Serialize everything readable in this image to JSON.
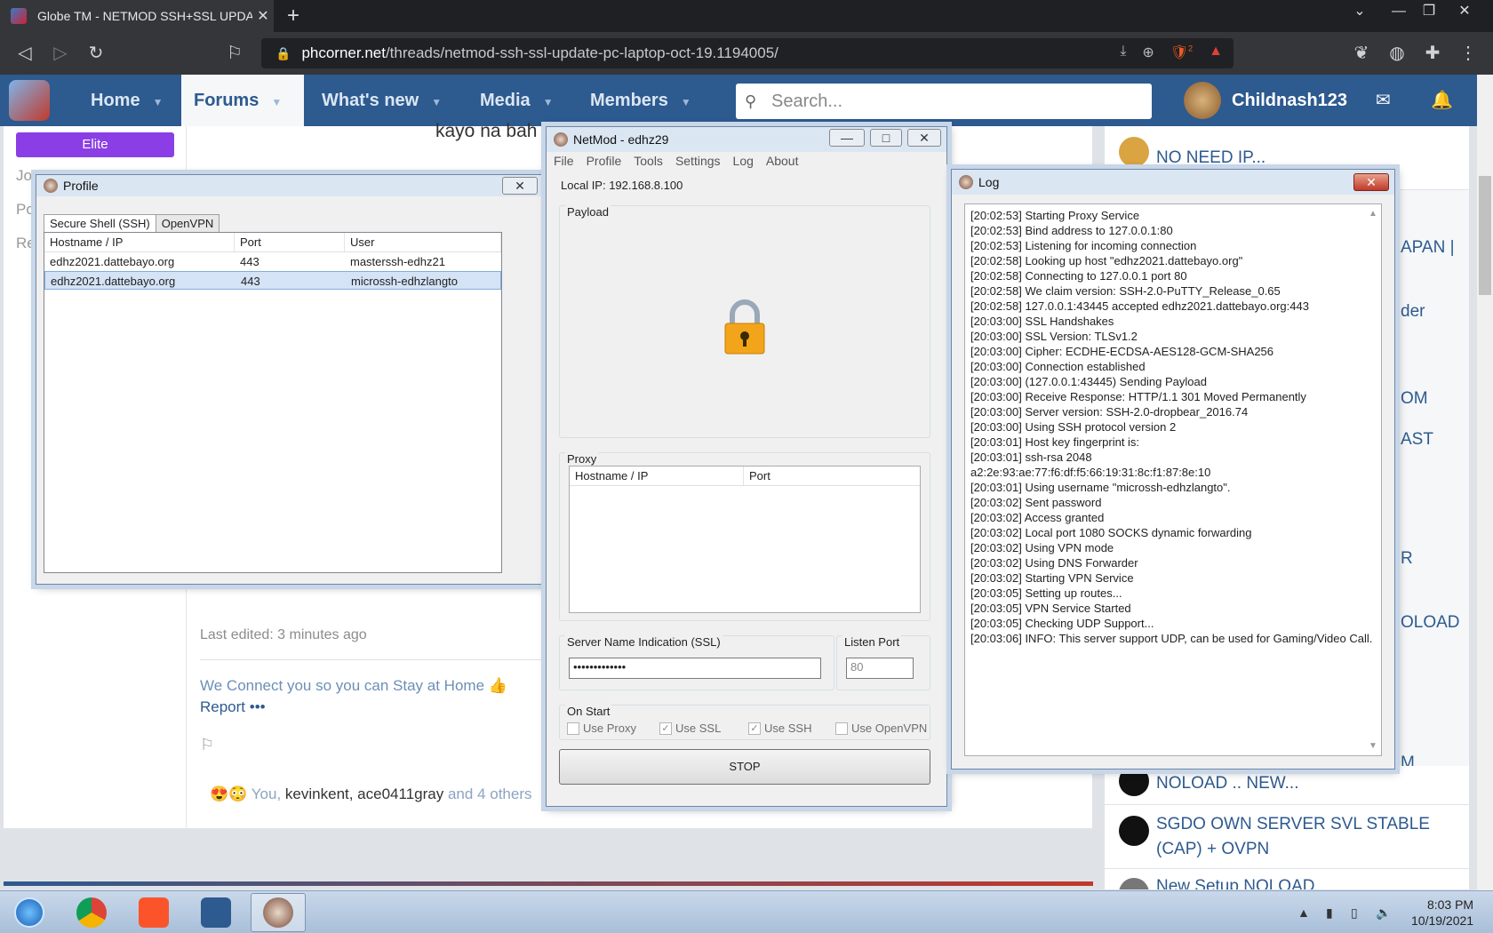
{
  "browser": {
    "tab_title": "Globe TM - NETMOD SSH+SSL UPDATE",
    "tab_close": "✕",
    "new_tab": "+",
    "url_host": "phcorner.net",
    "url_path": "/threads/netmod-ssh-ssl-update-pc-laptop-oct-19.1194005/",
    "shield_badge": "2"
  },
  "site": {
    "nav": [
      "Home",
      "Forums",
      "What's new",
      "Media",
      "Members"
    ],
    "search_placeholder": "Search...",
    "username": "Childnash123",
    "elite_badge": "Elite",
    "side_fragments": [
      "Jo",
      "Po",
      "Re"
    ],
    "post_fragment": "kayo na bah",
    "last_edited": "Last edited: 3 minutes ago",
    "signature": "We Connect you so you can Stay at Home 👍",
    "report": "Report •••",
    "reactions_emojis": "😍😳",
    "reactions_you": "You,",
    "reactions_users": "kevinkent, ace0411gray",
    "reactions_more": "and 4 others"
  },
  "right_column": {
    "items": [
      "NO NEED IP...",
      "NOLOAD .. NEW...",
      "SGDO OWN SERVER SVL STABLE (CAP) + OVPN",
      "New Setup NOLOAD"
    ],
    "fragments": [
      "APAN |",
      "der",
      "OM",
      "AST",
      "R",
      "OLOAD",
      "M"
    ]
  },
  "profile_window": {
    "title": "Profile",
    "tabs": [
      "Secure Shell (SSH)",
      "OpenVPN"
    ],
    "columns": [
      "Hostname / IP",
      "Port",
      "User"
    ],
    "rows": [
      {
        "host": "edhz2021.dattebayo.org",
        "port": "443",
        "user": "masterssh-edhz21"
      },
      {
        "host": "edhz2021.dattebayo.org",
        "port": "443",
        "user": "microssh-edhzlangto"
      }
    ]
  },
  "netmod_window": {
    "title": "NetMod - edhz29",
    "menu": [
      "File",
      "Profile",
      "Tools",
      "Settings",
      "Log",
      "About"
    ],
    "local_ip": "Local IP: 192.168.8.100",
    "payload_label": "Payload",
    "proxy_label": "Proxy",
    "proxy_columns": [
      "Hostname / IP",
      "Port"
    ],
    "sni_label": "Server Name Indication (SSL)",
    "sni_value": "•••••••••••••",
    "listen_port_label": "Listen Port",
    "listen_port_value": "80",
    "on_start_label": "On Start",
    "options": [
      {
        "label": "Use Proxy",
        "checked": false
      },
      {
        "label": "Use SSL",
        "checked": true
      },
      {
        "label": "Use SSH",
        "checked": true
      },
      {
        "label": "Use OpenVPN",
        "checked": false
      }
    ],
    "stop_label": "STOP"
  },
  "log_window": {
    "title": "Log",
    "lines": [
      "[20:02:53] Starting Proxy Service",
      "[20:02:53] Bind address to 127.0.0.1:80",
      "[20:02:53] Listening for incoming connection",
      "[20:02:58] Looking up host \"edhz2021.dattebayo.org\"",
      "[20:02:58] Connecting to 127.0.0.1 port 80",
      "[20:02:58] We claim version: SSH-2.0-PuTTY_Release_0.65",
      "[20:02:58] 127.0.0.1:43445 accepted edhz2021.dattebayo.org:443",
      "[20:03:00] SSL Handshakes",
      "[20:03:00] SSL Version: TLSv1.2",
      "[20:03:00] Cipher: ECDHE-ECDSA-AES128-GCM-SHA256",
      "[20:03:00] Connection established",
      "[20:03:00] (127.0.0.1:43445) Sending Payload",
      "[20:03:00] Receive Response: HTTP/1.1 301 Moved Permanently",
      "[20:03:00] Server version: SSH-2.0-dropbear_2016.74",
      "[20:03:00] Using SSH protocol version 2",
      "[20:03:01] Host key fingerprint is:",
      "[20:03:01] ssh-rsa 2048",
      "a2:2e:93:ae:77:f6:df:f5:66:19:31:8c:f1:87:8e:10",
      "[20:03:01] Using username \"microssh-edhzlangto\".",
      "[20:03:02] Sent password",
      "[20:03:02] Access granted",
      "[20:03:02] Local port 1080 SOCKS dynamic forwarding",
      "[20:03:02] Using VPN mode",
      "[20:03:02] Using DNS Forwarder",
      "[20:03:02] Starting VPN Service",
      "[20:03:05] Setting up routes...",
      "[20:03:05] VPN Service Started",
      "[20:03:05] Checking UDP Support...",
      "[20:03:06] INFO: This server support UDP, can be used for Gaming/Video Call."
    ]
  },
  "taskbar": {
    "time": "8:03 PM",
    "date": "10/19/2021"
  }
}
